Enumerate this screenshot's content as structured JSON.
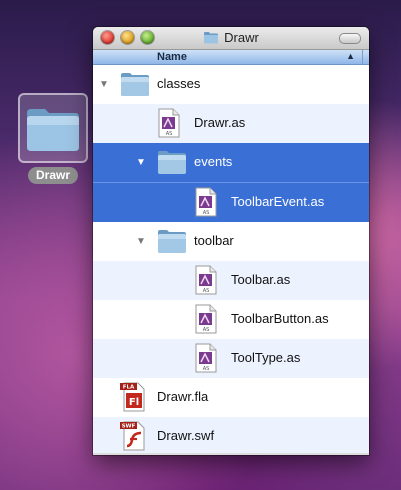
{
  "desktop": {
    "icon_label": "Drawr"
  },
  "window": {
    "title": "Drawr",
    "column_header": "Name",
    "sort_indicator": "▲"
  },
  "rows": [
    {
      "label": "classes",
      "type": "folder",
      "level": 0,
      "expanded": true,
      "selected": false,
      "alt": false
    },
    {
      "label": "Drawr.as",
      "type": "as",
      "level": 1,
      "expanded": null,
      "selected": false,
      "alt": true
    },
    {
      "label": "events",
      "type": "folder",
      "level": 1,
      "expanded": true,
      "selected": true,
      "alt": false
    },
    {
      "label": "ToolbarEvent.as",
      "type": "as",
      "level": 2,
      "expanded": null,
      "selected": true,
      "alt": true
    },
    {
      "label": "toolbar",
      "type": "folder",
      "level": 1,
      "expanded": true,
      "selected": false,
      "alt": false
    },
    {
      "label": "Toolbar.as",
      "type": "as",
      "level": 2,
      "expanded": null,
      "selected": false,
      "alt": true
    },
    {
      "label": "ToolbarButton.as",
      "type": "as",
      "level": 2,
      "expanded": null,
      "selected": false,
      "alt": false
    },
    {
      "label": "ToolType.as",
      "type": "as",
      "level": 2,
      "expanded": null,
      "selected": false,
      "alt": true
    },
    {
      "label": "Drawr.fla",
      "type": "fla",
      "level": 0,
      "expanded": null,
      "selected": false,
      "alt": false
    },
    {
      "label": "Drawr.swf",
      "type": "swf",
      "level": 0,
      "expanded": null,
      "selected": false,
      "alt": true
    }
  ],
  "file_badges": {
    "as": "AS",
    "fla": "FLA",
    "swf": "SWF",
    "fla_glyph": "Fl"
  },
  "colors": {
    "selection": "#3a6fd6",
    "alt_row": "#edf3fe",
    "folder": "#8fb9dc",
    "flash_red": "#c2281d"
  }
}
